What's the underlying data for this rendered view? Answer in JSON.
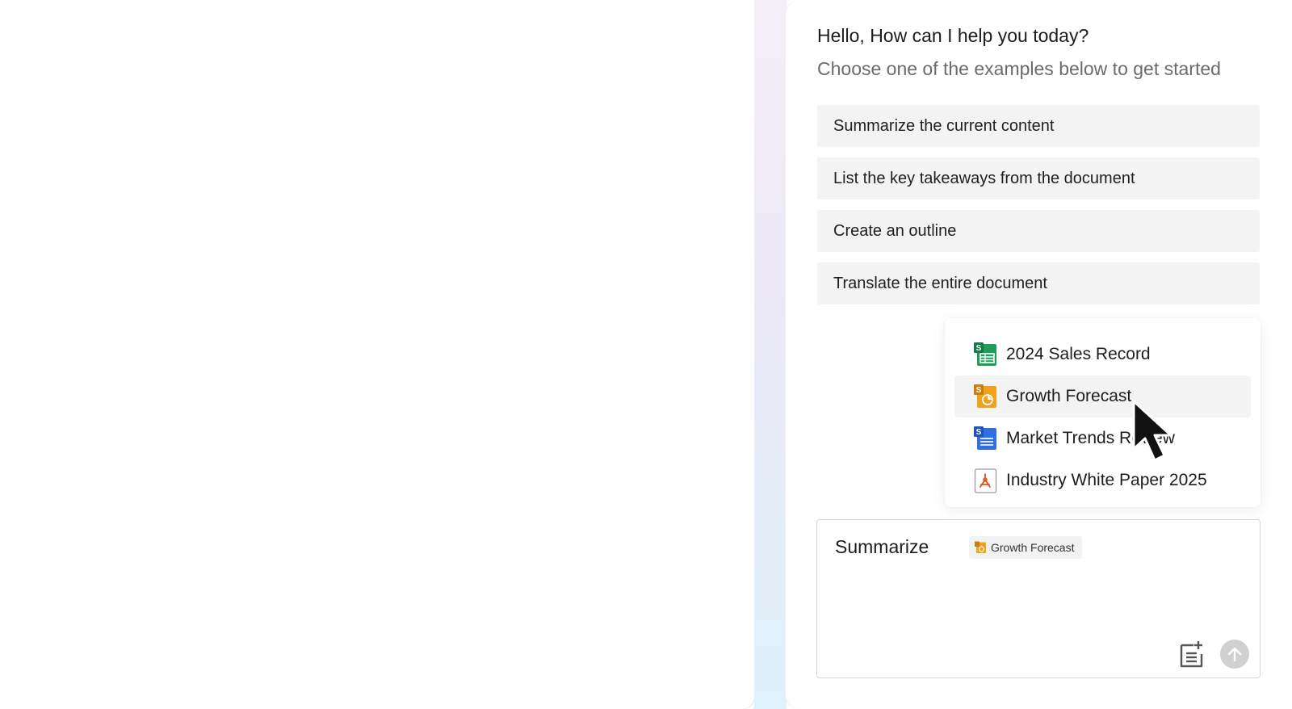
{
  "assistant": {
    "greeting": "Hello, How can I help you today?",
    "subtitle": "Choose one of the examples below to get started",
    "suggestions": [
      "Summarize the current content",
      "List the key takeaways from the document",
      "Create an outline",
      "Translate the entire document"
    ]
  },
  "mention_menu": {
    "items": [
      {
        "label": "2024 Sales Record",
        "icon": "spreadsheet-icon",
        "color": "#1e9e5a"
      },
      {
        "label": "Growth Forecast",
        "icon": "presentation-icon",
        "color": "#f0a21a",
        "active": true
      },
      {
        "label": "Market Trends Review",
        "icon": "document-icon",
        "color": "#2f6fe0"
      },
      {
        "label": "Industry White Paper 2025",
        "icon": "pdf-icon",
        "color": "#d9541e"
      }
    ]
  },
  "composer": {
    "text": "Summarize",
    "chip_label": "Growth Forecast"
  },
  "colors": {
    "panel_bg": "#ffffff",
    "suggestion_bg": "#f3f3f3",
    "send_disabled": "#d0d0d2"
  }
}
